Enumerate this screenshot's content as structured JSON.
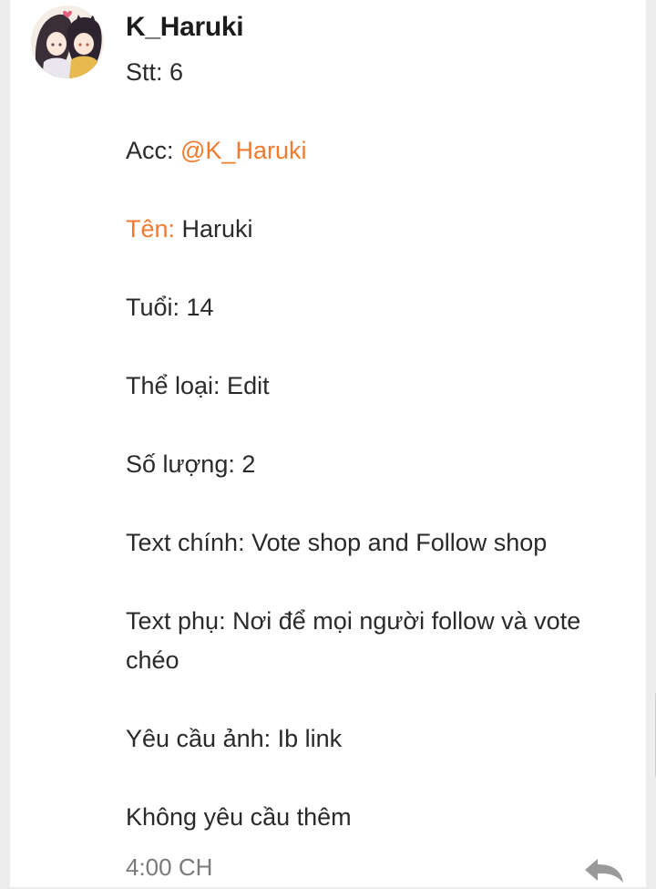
{
  "post": {
    "username": "K_Haruki",
    "stt_label": "Stt: ",
    "stt_value": "6",
    "acc_label": "Acc: ",
    "acc_mention": "@K_Haruki",
    "name_label": "Tên:",
    "name_value": " Haruki",
    "age_line": "Tuổi: 14",
    "genre_line": "Thể loại: Edit",
    "quantity_line": "Số lượng: 2",
    "main_text_line": "Text chính: Vote shop and Follow shop",
    "sub_text_line": "Text phụ: Nơi để mọi người follow và vote chéo",
    "image_request_line": "Yêu cầu ảnh: Ib link",
    "extra_line": "Không yêu cầu thêm",
    "timestamp": "4:00 CH"
  },
  "colors": {
    "accent": "#f07a2d",
    "text": "#2a2a2a",
    "muted": "#7a7a7a",
    "background": "#ededed"
  },
  "icons": {
    "avatar": "user-avatar-illustration",
    "reply": "reply-arrow-icon"
  }
}
